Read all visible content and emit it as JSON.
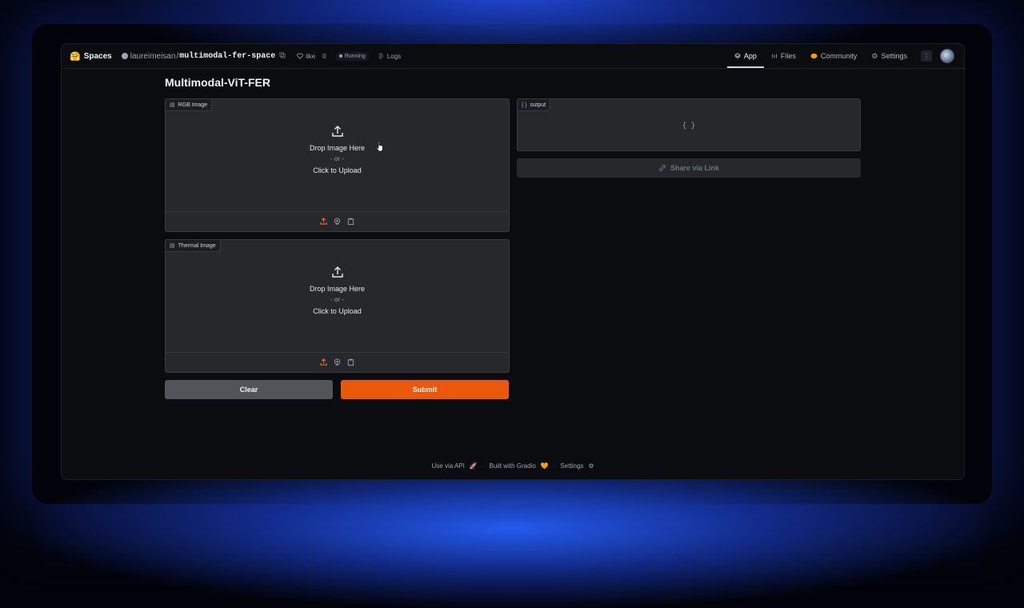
{
  "header": {
    "logo_emoji": "🤗",
    "spaces_label": "Spaces",
    "owner": "laureimeisan",
    "repo": "multimodal-fer-space",
    "like_label": "like",
    "like_count": "0",
    "status": "Running",
    "logs_label": "Logs",
    "tabs": [
      {
        "label": "App",
        "icon": "app-icon",
        "active": true
      },
      {
        "label": "Files",
        "icon": "files-icon",
        "active": false
      },
      {
        "label": "Community",
        "icon": "community-icon",
        "active": false
      },
      {
        "label": "Settings",
        "icon": "gear-icon",
        "active": false
      }
    ],
    "menu_glyph": "⋮"
  },
  "app": {
    "title": "Multimodal-ViT-FER",
    "rgb_panel": {
      "label": "RGB Image",
      "drop_text": "Drop Image Here",
      "or_text": "- or -",
      "click_text": "Click to Upload"
    },
    "thermal_panel": {
      "label": "Thermal Image",
      "drop_text": "Drop Image Here",
      "or_text": "- or -",
      "click_text": "Click to Upload"
    },
    "output_panel": {
      "label": "output",
      "value": "{ }"
    },
    "share_label": "Share via Link",
    "clear_label": "Clear",
    "submit_label": "Submit"
  },
  "footer": {
    "api_label": "Use via API",
    "api_emoji": "🚀",
    "built_label": "Built with Gradio",
    "built_emoji": "🧡",
    "settings_label": "Settings",
    "separator": "·"
  },
  "colors": {
    "accent": "#ea580c",
    "background": "#0b0c0f",
    "panel": "#27282c"
  }
}
